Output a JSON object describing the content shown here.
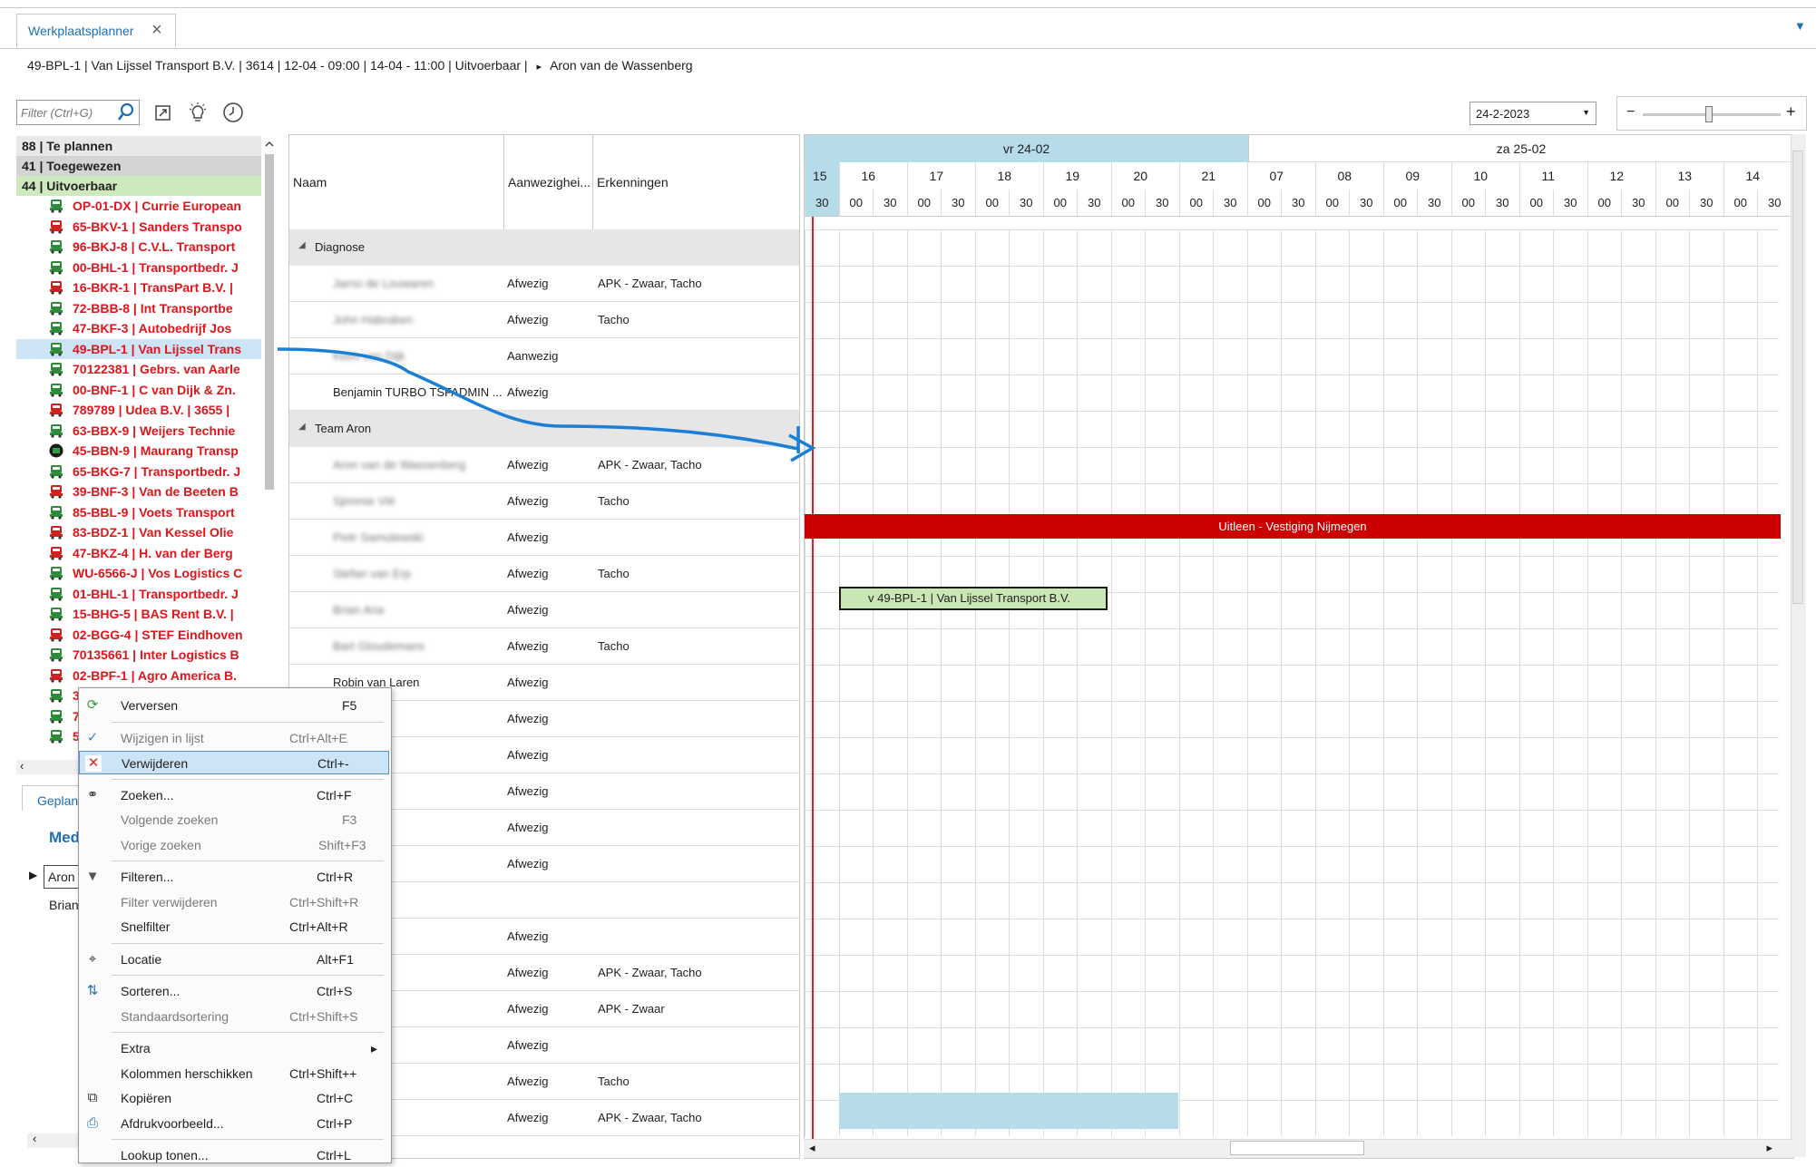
{
  "tab": {
    "label": "Werkplaatsplanner",
    "close": "×",
    "dropdown": "▼"
  },
  "infobar": {
    "text": "49-BPL-1 | Van Lijssel Transport B.V. | 3614 | 12-04 - 09:00 | 14-04 - 11:00 | Uitvoerbaar |",
    "marker": "▸",
    "person": "Aron van de Wassenberg"
  },
  "filter": {
    "placeholder": "Filter (Ctrl+G)"
  },
  "tree": {
    "groups": [
      {
        "label": "88 | Te plannen"
      },
      {
        "label": "41 | Toegewezen"
      },
      {
        "label": "44 | Uitvoerbaar"
      }
    ],
    "vehicles": [
      {
        "label": "OP-01-DX | Currie European",
        "icon": "green"
      },
      {
        "label": "65-BKV-1 | Sanders Transpo",
        "icon": "red"
      },
      {
        "label": "96-BKJ-8 | C.V.L. Transport",
        "icon": "green"
      },
      {
        "label": "00-BHL-1 | Transportbedr. J",
        "icon": "green"
      },
      {
        "label": "16-BKR-1 | TransPart B.V. |",
        "icon": "red"
      },
      {
        "label": "72-BBB-8 | Int Transportbe",
        "icon": "green"
      },
      {
        "label": "47-BKF-3 | Autobedrijf Jos",
        "icon": "green"
      },
      {
        "label": "49-BPL-1 | Van Lijssel Trans",
        "icon": "green",
        "selected": true
      },
      {
        "label": "70122381 | Gebrs. van Aarle",
        "icon": "green"
      },
      {
        "label": "00-BNF-1 | C van Dijk & Zn.",
        "icon": "green"
      },
      {
        "label": "789789 | Udea B.V. | 3655 |",
        "icon": "red"
      },
      {
        "label": "63-BBX-9 | Weijers Technie",
        "icon": "green"
      },
      {
        "label": "45-BBN-9 | Maurang Transp",
        "icon": "dark"
      },
      {
        "label": "65-BKG-7 | Transportbedr. J",
        "icon": "green"
      },
      {
        "label": "39-BNF-3 | Van de Beeten B",
        "icon": "red"
      },
      {
        "label": "85-BBL-9 | Voets Transport",
        "icon": "green"
      },
      {
        "label": "83-BDZ-1 | Van Kessel Olie",
        "icon": "red"
      },
      {
        "label": "47-BKZ-4 | H. van der Berg",
        "icon": "red"
      },
      {
        "label": "WU-6566-J | Vos Logistics C",
        "icon": "green"
      },
      {
        "label": "01-BHL-1 | Transportbedr. J",
        "icon": "green"
      },
      {
        "label": "15-BHG-5 | BAS Rent B.V. |",
        "icon": "green"
      },
      {
        "label": "02-BGG-4 | STEF Eindhoven",
        "icon": "red"
      },
      {
        "label": "70135661 | Inter Logistics B",
        "icon": "green"
      },
      {
        "label": "02-BPF-1 | Agro America B.",
        "icon": "red"
      },
      {
        "label": "3",
        "icon": "green"
      },
      {
        "label": "7",
        "icon": "green"
      },
      {
        "label": "5",
        "icon": "green"
      }
    ]
  },
  "bottom_left": {
    "tab": "Geplan",
    "heading": "Med",
    "item1": "Aron",
    "item2": "Brian"
  },
  "table": {
    "headers": [
      "Naam",
      "Aanwezighei...",
      "Erkenningen"
    ],
    "rows": [
      {
        "type": "group",
        "name": "Diagnose"
      },
      {
        "type": "emp",
        "name": "Jarno de Louwaren",
        "blur": true,
        "status": "Afwezig",
        "erk": "APK - Zwaar, Tacho"
      },
      {
        "type": "emp",
        "name": "John Habraken",
        "blur": true,
        "status": "Afwezig",
        "erk": "Tacho"
      },
      {
        "type": "emp",
        "name": "Kees van Dijk",
        "blur": true,
        "status": "Aanwezig",
        "erk": ""
      },
      {
        "type": "emp",
        "name": "Benjamin TURBO TSFADMIN ...",
        "blur": false,
        "status": "Afwezig",
        "erk": ""
      },
      {
        "type": "group",
        "name": "Team Aron"
      },
      {
        "type": "emp",
        "name": "Aron van de Wassenberg",
        "blur": true,
        "status": "Afwezig",
        "erk": "APK - Zwaar, Tacho"
      },
      {
        "type": "emp",
        "name": "Sjimmie Vlé",
        "blur": true,
        "status": "Afwezig",
        "erk": "Tacho"
      },
      {
        "type": "emp",
        "name": "Piotr Samulewski",
        "blur": true,
        "status": "Afwezig",
        "erk": ""
      },
      {
        "type": "emp",
        "name": "Stefan van Erp",
        "blur": true,
        "status": "Afwezig",
        "erk": "Tacho"
      },
      {
        "type": "emp",
        "name": "Brian Aria",
        "blur": true,
        "status": "Afwezig",
        "erk": ""
      },
      {
        "type": "emp",
        "name": "Bart Gloudemans",
        "blur": true,
        "status": "Afwezig",
        "erk": "Tacho"
      },
      {
        "type": "emp",
        "name": "Robin van Laren",
        "blur": false,
        "status": "Afwezig",
        "erk": ""
      },
      {
        "type": "emp",
        "name": "w",
        "blur": false,
        "status": "Afwezig",
        "erk": ""
      },
      {
        "type": "emp",
        "name": "s",
        "blur": false,
        "status": "Afwezig",
        "erk": ""
      },
      {
        "type": "emp",
        "name": "le Camp",
        "blur": false,
        "status": "Afwezig",
        "erk": ""
      },
      {
        "type": "emp",
        "name": "an de Rijdt",
        "blur": false,
        "status": "Afwezig",
        "erk": ""
      },
      {
        "type": "emp",
        "name": "s",
        "blur": false,
        "status": "Afwezig",
        "erk": ""
      },
      {
        "type": "emp",
        "name": "",
        "blur": false,
        "status": "",
        "erk": ""
      },
      {
        "type": "emp",
        "name": "ogers",
        "blur": false,
        "status": "Afwezig",
        "erk": ""
      },
      {
        "type": "emp",
        "name": "Santvoort",
        "blur": false,
        "status": "Afwezig",
        "erk": "APK - Zwaar, Tacho"
      },
      {
        "type": "emp",
        "name": "eer",
        "blur": false,
        "status": "Afwezig",
        "erk": "APK - Zwaar"
      },
      {
        "type": "emp",
        "name": "of",
        "blur": false,
        "status": "Afwezig",
        "erk": ""
      },
      {
        "type": "emp",
        "name": "elis",
        "blur": false,
        "status": "Afwezig",
        "erk": "Tacho"
      },
      {
        "type": "emp",
        "name": "ers",
        "blur": false,
        "status": "Afwezig",
        "erk": "APK - Zwaar, Tacho"
      }
    ]
  },
  "gantt": {
    "day1": "vr 24-02",
    "day2": "za 25-02",
    "hours": [
      "15",
      "16",
      "17",
      "18",
      "19",
      "20",
      "21",
      "07",
      "08",
      "09",
      "10",
      "11",
      "12",
      "13",
      "14"
    ],
    "minutes": [
      "30",
      "00",
      "30",
      "00",
      "30",
      "00",
      "30",
      "00",
      "30",
      "00",
      "30",
      "00",
      "30",
      "00",
      "30",
      "00",
      "30",
      "00",
      "30",
      "00",
      "30",
      "00",
      "30",
      "00",
      "30",
      "00",
      "30",
      "00",
      "30"
    ],
    "uitleen": "Uitleen - Vestiging Nijmegen",
    "job": "v  49-BPL-1 | Van Lijssel Transport B.V."
  },
  "date": {
    "value": "24-2-2023"
  },
  "zoom": {
    "minus": "−",
    "plus": "+",
    "level": 0.48
  },
  "context_menu": [
    {
      "label": "Verversen",
      "shortcut": "F5",
      "icon": "refresh-icon",
      "glyph": "⟳",
      "color": "#3b9a3b",
      "disabled": false
    },
    {
      "sep": true
    },
    {
      "label": "Wijzigen in lijst",
      "shortcut": "Ctrl+Alt+E",
      "icon": "check-icon",
      "glyph": "✓",
      "color": "#4a7fbf",
      "disabled": true
    },
    {
      "label": "Verwijderen",
      "shortcut": "Ctrl+-",
      "icon": "delete-icon",
      "glyph": "✕",
      "color": "#d9251d",
      "disabled": false,
      "highlight": true
    },
    {
      "sep": true
    },
    {
      "label": "Zoeken...",
      "shortcut": "Ctrl+F",
      "icon": "binoculars-icon",
      "glyph": "⚭",
      "color": "#333",
      "disabled": false
    },
    {
      "label": "Volgende zoeken",
      "shortcut": "F3",
      "icon": "",
      "glyph": "",
      "color": "",
      "disabled": true
    },
    {
      "label": "Vorige zoeken",
      "shortcut": "Shift+F3",
      "icon": "",
      "glyph": "",
      "color": "",
      "disabled": true
    },
    {
      "sep": true
    },
    {
      "label": "Filteren...",
      "shortcut": "Ctrl+R",
      "icon": "funnel-icon",
      "glyph": "▼",
      "color": "#555",
      "disabled": false
    },
    {
      "label": "Filter verwijderen",
      "shortcut": "Ctrl+Shift+R",
      "icon": "",
      "glyph": "",
      "color": "",
      "disabled": true
    },
    {
      "label": "Snelfilter",
      "shortcut": "Ctrl+Alt+R",
      "icon": "",
      "glyph": "",
      "color": "",
      "disabled": false
    },
    {
      "sep": true
    },
    {
      "label": "Locatie",
      "shortcut": "Alt+F1",
      "icon": "location-icon",
      "glyph": "⌖",
      "color": "#333",
      "disabled": false
    },
    {
      "sep": true
    },
    {
      "label": "Sorteren...",
      "shortcut": "Ctrl+S",
      "icon": "sort-icon",
      "glyph": "⇅",
      "color": "#2a6fb8",
      "disabled": false
    },
    {
      "label": "Standaardsortering",
      "shortcut": "Ctrl+Shift+S",
      "icon": "",
      "glyph": "",
      "color": "",
      "disabled": true
    },
    {
      "sep": true
    },
    {
      "label": "Extra",
      "shortcut": "",
      "icon": "",
      "glyph": "",
      "color": "",
      "disabled": false,
      "submenu": true
    },
    {
      "label": "Kolommen herschikken",
      "shortcut": "Ctrl+Shift++",
      "icon": "",
      "glyph": "",
      "color": "",
      "disabled": false
    },
    {
      "label": "Kopiëren",
      "shortcut": "Ctrl+C",
      "icon": "copy-icon",
      "glyph": "⧉",
      "color": "#333",
      "disabled": false
    },
    {
      "label": "Afdrukvoorbeeld...",
      "shortcut": "Ctrl+P",
      "icon": "print-preview-icon",
      "glyph": "⎙",
      "color": "#2a6fb8",
      "disabled": false
    },
    {
      "sep": true
    },
    {
      "label": "Lookup tonen...",
      "shortcut": "Ctrl+L",
      "icon": "",
      "glyph": "",
      "color": "",
      "disabled": false
    }
  ],
  "colors": {
    "accent": "#1f6fb5",
    "red": "#e0151b",
    "uitleen": "#cc0000",
    "job": "#c9e6b5",
    "blue_block": "#b7dce9"
  }
}
